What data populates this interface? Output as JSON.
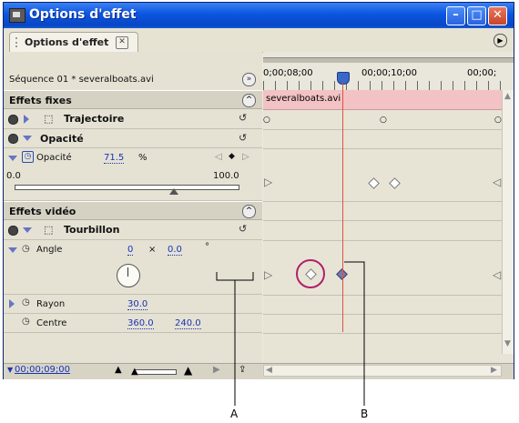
{
  "window": {
    "title": "Options d'effet",
    "tab_label": "Options d'effet"
  },
  "sequence": {
    "label": "Séquence 01 * severalboats.avi"
  },
  "timeline": {
    "times": [
      "0;00;08;00",
      "00;00;10;00",
      "00;00;"
    ],
    "clip_name": "severalboats.avi",
    "current_time": "00;00;09;00"
  },
  "sections": {
    "fixed": "Effets fixes",
    "video": "Effets vidéo"
  },
  "effects": {
    "trajectoire": {
      "name": "Trajectoire"
    },
    "opacite": {
      "name": "Opacité",
      "param": "Opacité",
      "value": "71.5",
      "unit": "%",
      "min": "0.0",
      "max": "100.0",
      "level_fraction": 0.715
    },
    "tourbillon": {
      "name": "Tourbillon",
      "angle": {
        "label": "Angle",
        "turns": "0",
        "times": "×",
        "degrees": "0.0",
        "deg_sign": "°"
      },
      "rayon": {
        "label": "Rayon",
        "value": "30.0"
      },
      "centre": {
        "label": "Centre",
        "x": "360.0",
        "y": "240.0"
      }
    }
  },
  "callouts": {
    "a": "A",
    "b": "B"
  },
  "icons": {
    "app": "premiere-app-icon",
    "close_tab": "close-tab-icon",
    "panel_menu": "panel-menu-icon",
    "playhead": "playhead-icon",
    "keyframe": "keyframe-diamond-icon",
    "stopwatch": "stopwatch-icon",
    "reset": "reset-icon",
    "motion": "motion-effect-icon"
  },
  "colors": {
    "titlebar": "#0b55e0",
    "clip_bar": "#f3c2c4",
    "playhead_line": "#e05040",
    "value_text": "#1a33b5",
    "highlight_circle": "#b0206a"
  }
}
